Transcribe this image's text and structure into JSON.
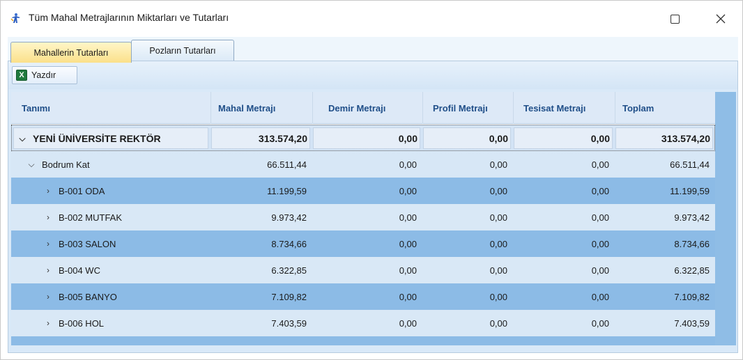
{
  "window": {
    "title": "Tüm Mahal Metrajlarının Miktarları ve Tutarları",
    "maximize_glyph": "",
    "close_glyph": "✕"
  },
  "tabs": [
    {
      "label": "Mahallerin Tutarları",
      "active": true
    },
    {
      "label": "Pozların Tutarları",
      "active": false
    }
  ],
  "toolbar": {
    "print_label": "Yazdır",
    "print_icon": "excel-icon"
  },
  "grid": {
    "columns": [
      "Tanımı",
      "Mahal Metrajı",
      "Demir Metrajı",
      "Profil Metrajı",
      "Tesisat Metrajı",
      "Toplam"
    ],
    "root": {
      "name": "YENİ ÜNİVERSİTE REKTÖR",
      "values": [
        "313.574,20",
        "0,00",
        "0,00",
        "0,00",
        "313.574,20"
      ]
    },
    "group": {
      "name": "Bodrum Kat",
      "values": [
        "66.511,44",
        "0,00",
        "0,00",
        "0,00",
        "66.511,44"
      ]
    },
    "rows": [
      {
        "name": "B-001 ODA",
        "values": [
          "11.199,59",
          "0,00",
          "0,00",
          "0,00",
          "11.199,59"
        ]
      },
      {
        "name": "B-002 MUTFAK",
        "values": [
          "9.973,42",
          "0,00",
          "0,00",
          "0,00",
          "9.973,42"
        ]
      },
      {
        "name": "B-003 SALON",
        "values": [
          "8.734,66",
          "0,00",
          "0,00",
          "0,00",
          "8.734,66"
        ]
      },
      {
        "name": "B-004 WC",
        "values": [
          "6.322,85",
          "0,00",
          "0,00",
          "0,00",
          "6.322,85"
        ]
      },
      {
        "name": "B-005 BANYO",
        "values": [
          "7.109,82",
          "0,00",
          "0,00",
          "0,00",
          "7.109,82"
        ]
      },
      {
        "name": "B-006 HOL",
        "values": [
          "7.403,59",
          "0,00",
          "0,00",
          "0,00",
          "7.403,59"
        ]
      }
    ]
  },
  "colors": {
    "header_text": "#1f4e88",
    "row_highlight": "#8cbbe6",
    "row_normal": "#d9e8f6",
    "active_tab": "#fbe08a"
  }
}
